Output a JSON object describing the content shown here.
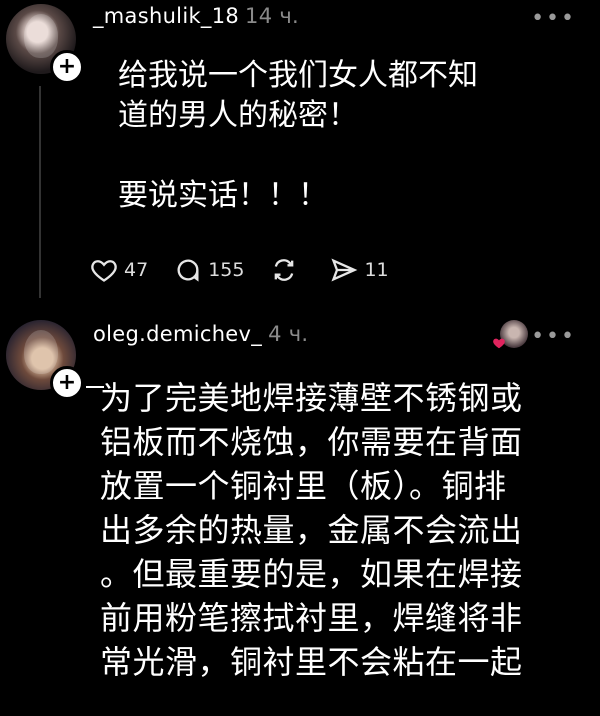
{
  "posts": [
    {
      "username": "_mashulik_18",
      "time": "14 ч.",
      "text": "给我说一个我们女人都不知\n道的男人的秘密！\n\n要说实话！！！",
      "likes": "47",
      "comments": "155",
      "shares": "11",
      "icons": [
        "heart-icon",
        "comment-icon",
        "repost-icon",
        "send-icon"
      ]
    },
    {
      "username": "oleg.demichev_",
      "time": "4 ч.",
      "text": "为了完美地焊接薄壁不锈钢或\n铝板而不烧蚀，你需要在背面\n放置一个铜衬里（板）。铜排\n出多余的热量，金属不会流出\n。但最重要的是，如果在焊接\n前用粉笔擦拭衬里，焊缝将非\n常光滑，铜衬里不会粘在一起"
    }
  ],
  "colors": {
    "background": "#000000",
    "text": "#ffffff",
    "muted": "#8a8a8a",
    "heart": "#e0245e"
  }
}
